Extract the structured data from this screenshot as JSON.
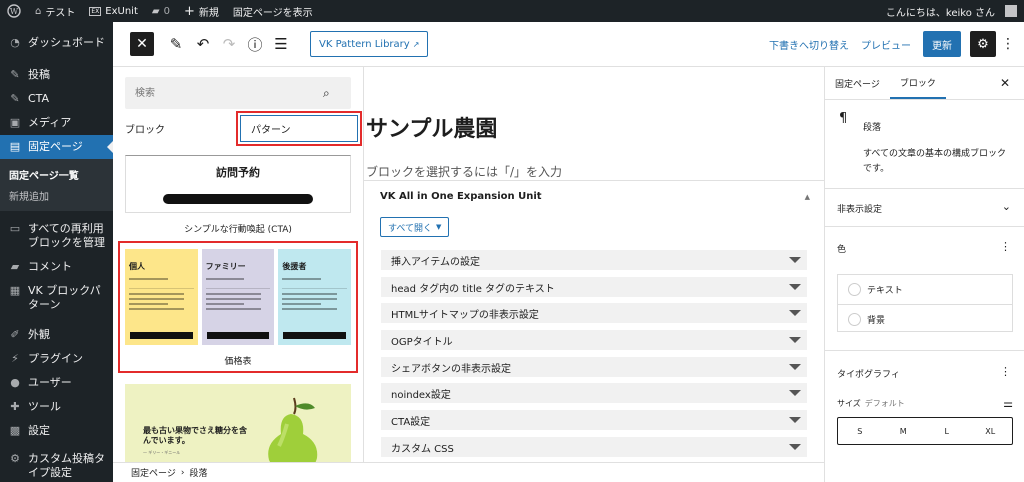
{
  "adminbar": {
    "site_name": "テスト",
    "exunit": "ExUnit",
    "comments_count": "0",
    "new_label": "新規",
    "view_page": "固定ページを表示",
    "greeting": "こんにちは、keiko さん"
  },
  "adminmenu": {
    "items": [
      {
        "label": "ダッシュボード",
        "icon": "dashboard-icon"
      },
      {
        "label": "投稿",
        "icon": "pin-icon"
      },
      {
        "label": "CTA",
        "icon": "pin-icon"
      },
      {
        "label": "メディア",
        "icon": "media-icon"
      },
      {
        "label": "固定ページ",
        "icon": "page-icon"
      },
      {
        "label": "すべての再利用ブロックを管理",
        "icon": "reusable-icon"
      },
      {
        "label": "コメント",
        "icon": "comment-icon"
      },
      {
        "label": "VK ブロックパターン",
        "icon": "pattern-icon"
      },
      {
        "label": "外観",
        "icon": "appearance-icon"
      },
      {
        "label": "プラグイン",
        "icon": "plugin-icon"
      },
      {
        "label": "ユーザー",
        "icon": "user-icon"
      },
      {
        "label": "ツール",
        "icon": "tool-icon"
      },
      {
        "label": "設定",
        "icon": "settings-icon"
      },
      {
        "label": "カスタム投稿タイプ設定",
        "icon": "gear-icon"
      }
    ],
    "submenu": [
      "固定ページ一覧",
      "新規追加"
    ]
  },
  "header": {
    "vk_pattern_library": "VK Pattern Library",
    "switch_draft": "下書きへ切り替え",
    "preview": "プレビュー",
    "update": "更新"
  },
  "inserter": {
    "search_placeholder": "検索",
    "tab_blocks": "ブロック",
    "tab_patterns": "パターン",
    "cta_card_title": "訪問予約",
    "cta_pattern_label": "シンプルな行動喚起 (CTA)",
    "price_columns": [
      {
        "title": "個人",
        "color": "#fde68a"
      },
      {
        "title": "ファミリー",
        "color": "#d6d3e6"
      },
      {
        "title": "後援者",
        "color": "#bfe8ef"
      }
    ],
    "price_pattern_label": "価格表",
    "pear_title": "最も古い果物でさえ糖分を含んでいます。",
    "pear_sub": "— ギリー・ギニール"
  },
  "canvas": {
    "title": "サンプル農園",
    "placeholder": "ブロックを選択するには「/」を入力",
    "vk_panel_title": "VK All in One Expansion Unit",
    "open_all": "すべて開く",
    "accordions": [
      "挿入アイテムの設定",
      "head タグ内の title タグのテキスト",
      "HTMLサイトマップの非表示設定",
      "OGPタイトル",
      "シェアボタンの非表示設定",
      "noindex設定",
      "CTA設定",
      "カスタム CSS"
    ]
  },
  "footer": {
    "crumb_page": "固定ページ",
    "crumb_block": "段落"
  },
  "sidebar": {
    "tab_page": "固定ページ",
    "tab_block": "ブロック",
    "block_name": "段落",
    "block_desc": "すべての文章の基本の構成ブロックです。",
    "hidden_settings": "非表示設定",
    "color": "色",
    "text_label": "テキスト",
    "bg_label": "背景",
    "typography": "タイポグラフィ",
    "size_label": "サイズ",
    "size_default": "デフォルト",
    "sizes": [
      "S",
      "M",
      "L",
      "XL"
    ]
  }
}
